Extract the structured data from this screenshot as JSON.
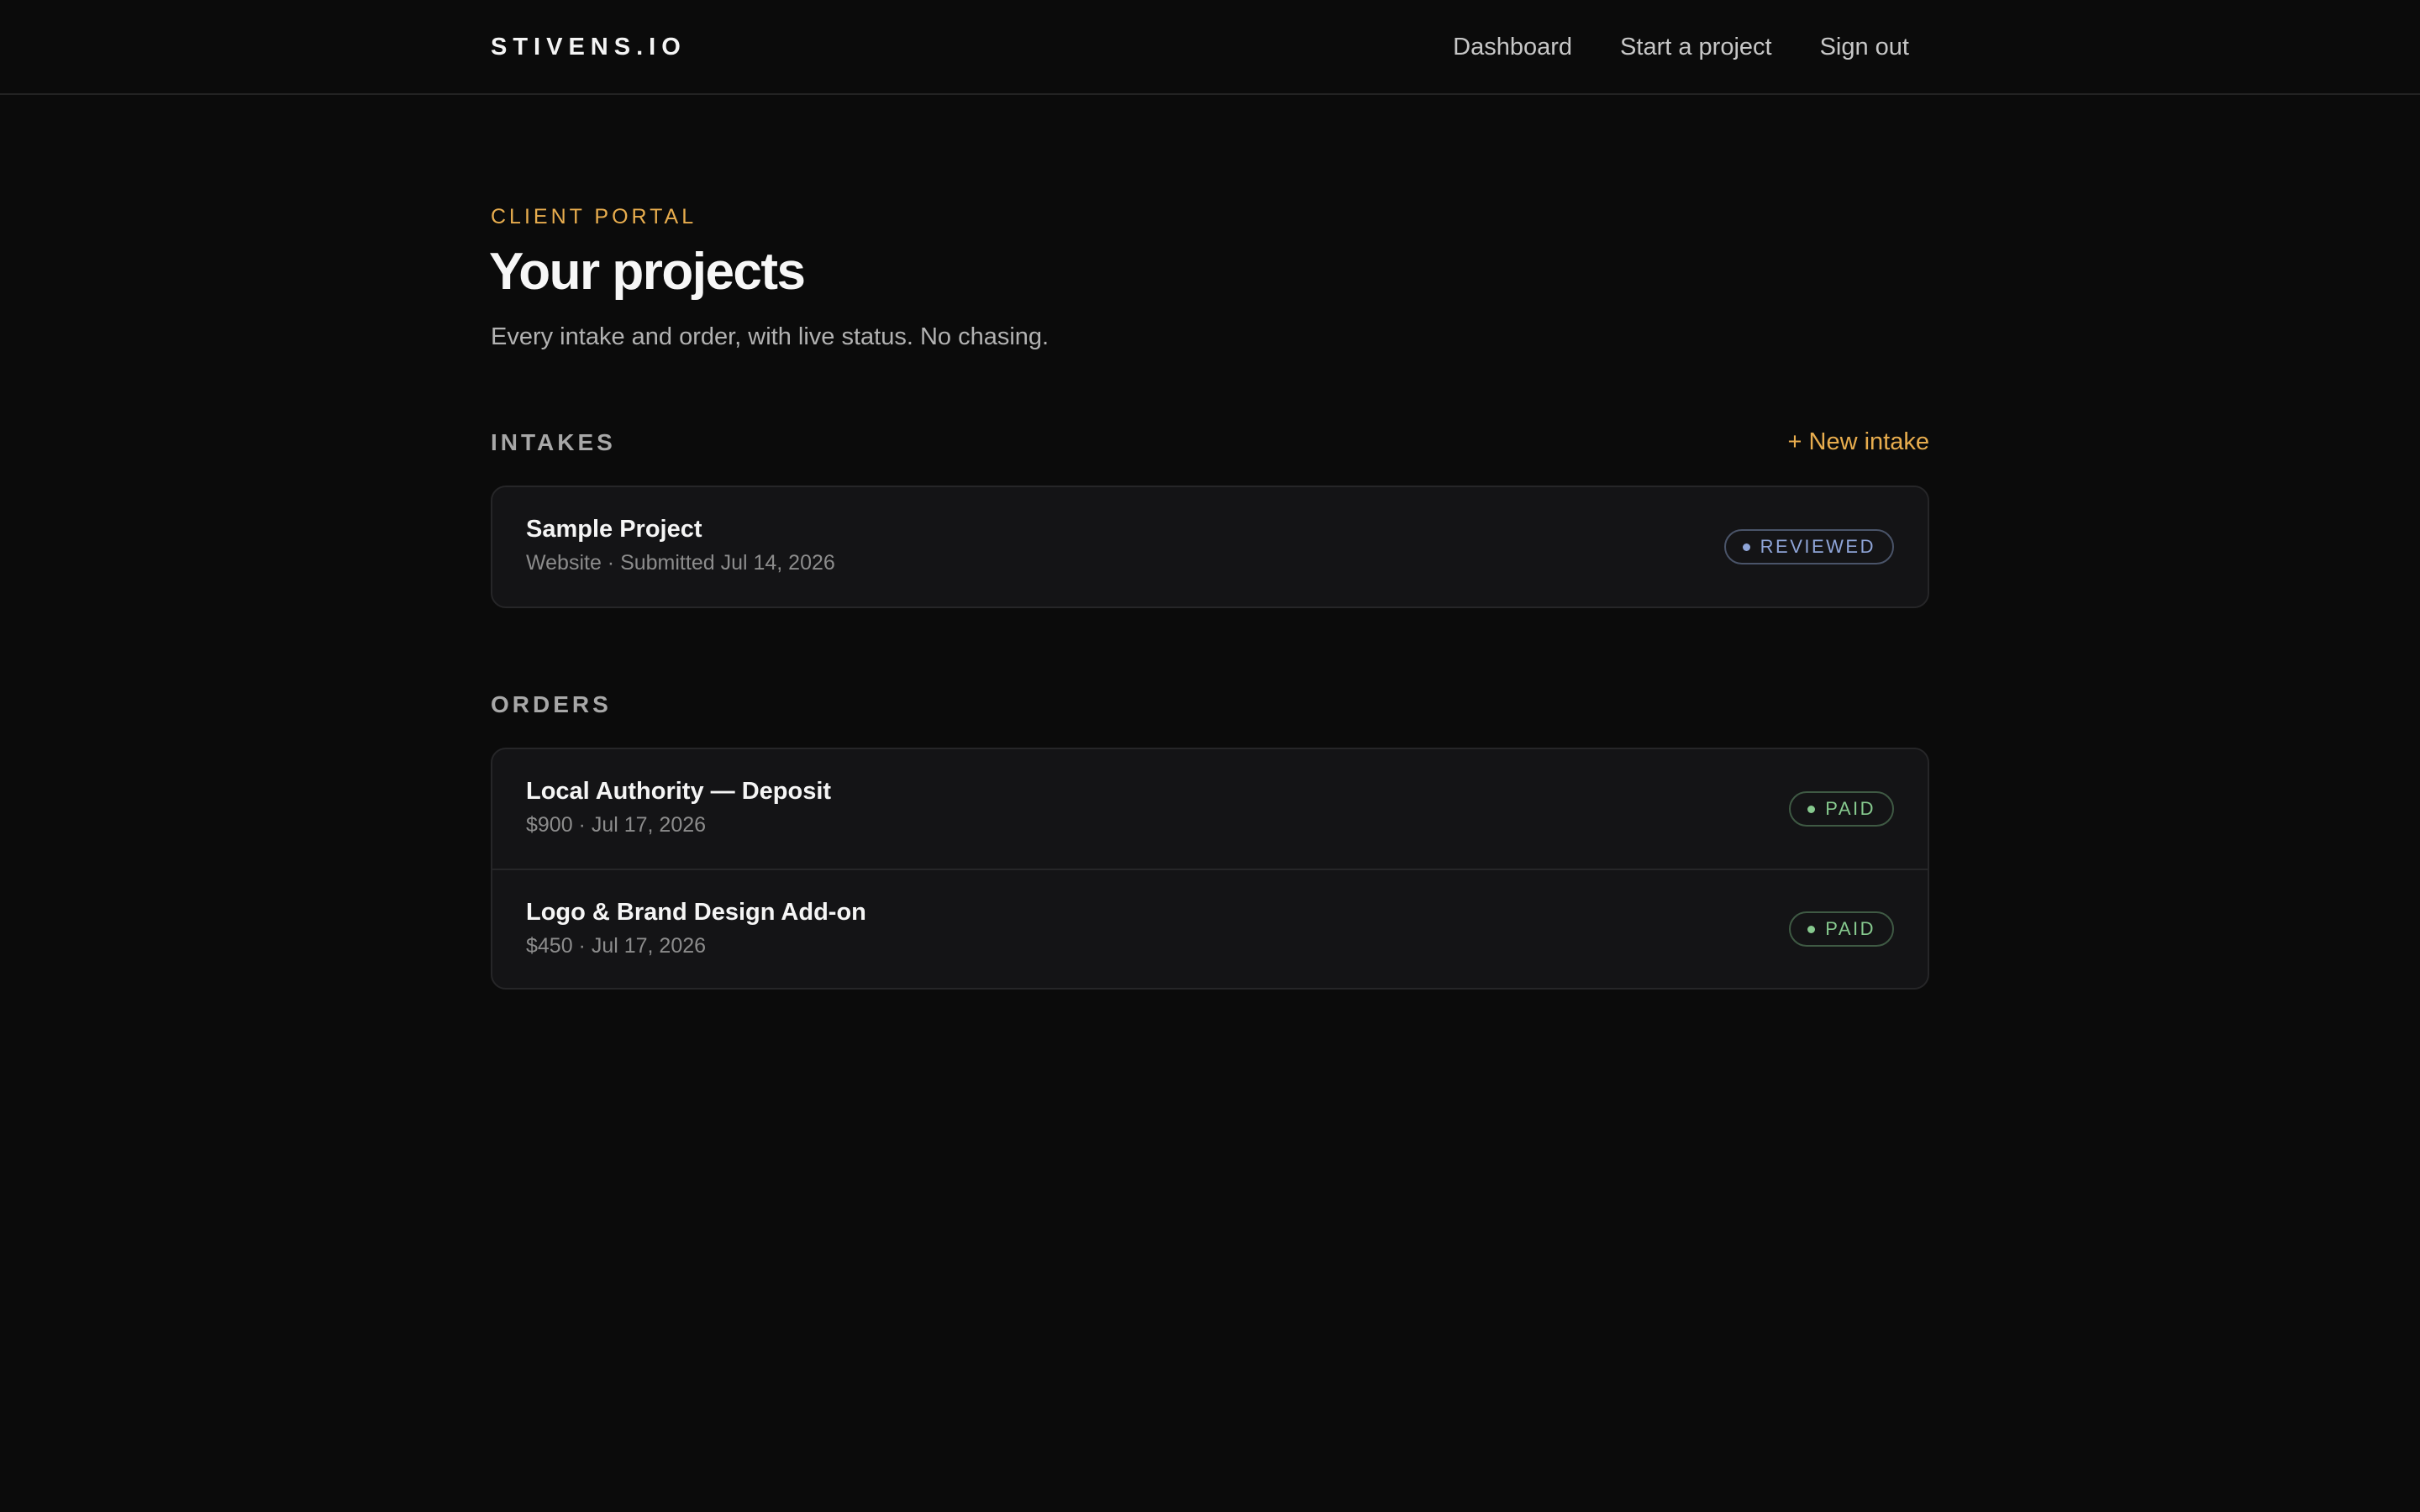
{
  "header": {
    "brand": "STIVENS.IO",
    "nav": [
      "Dashboard",
      "Start a project",
      "Sign out"
    ]
  },
  "hero": {
    "eyebrow": "CLIENT PORTAL",
    "title": "Your projects",
    "subtitle": "Every intake and order, with live status. No chasing."
  },
  "intakes": {
    "label": "INTAKES",
    "new_label": "+ New intake",
    "items": [
      {
        "title": "Sample Project",
        "meta": "Website · Submitted Jul 14, 2026",
        "status": "REVIEWED"
      }
    ]
  },
  "orders": {
    "label": "ORDERS",
    "items": [
      {
        "title": "Local Authority — Deposit",
        "meta": "$900 · Jul 17, 2026",
        "status": "PAID"
      },
      {
        "title": "Logo & Brand Design Add-on",
        "meta": "$450 · Jul 17, 2026",
        "status": "PAID"
      }
    ]
  },
  "colors": {
    "background": "#0b0b0b",
    "accent": "#e8ad4e",
    "status_reviewed": "#8fa5d8",
    "status_paid": "#86c98e"
  }
}
